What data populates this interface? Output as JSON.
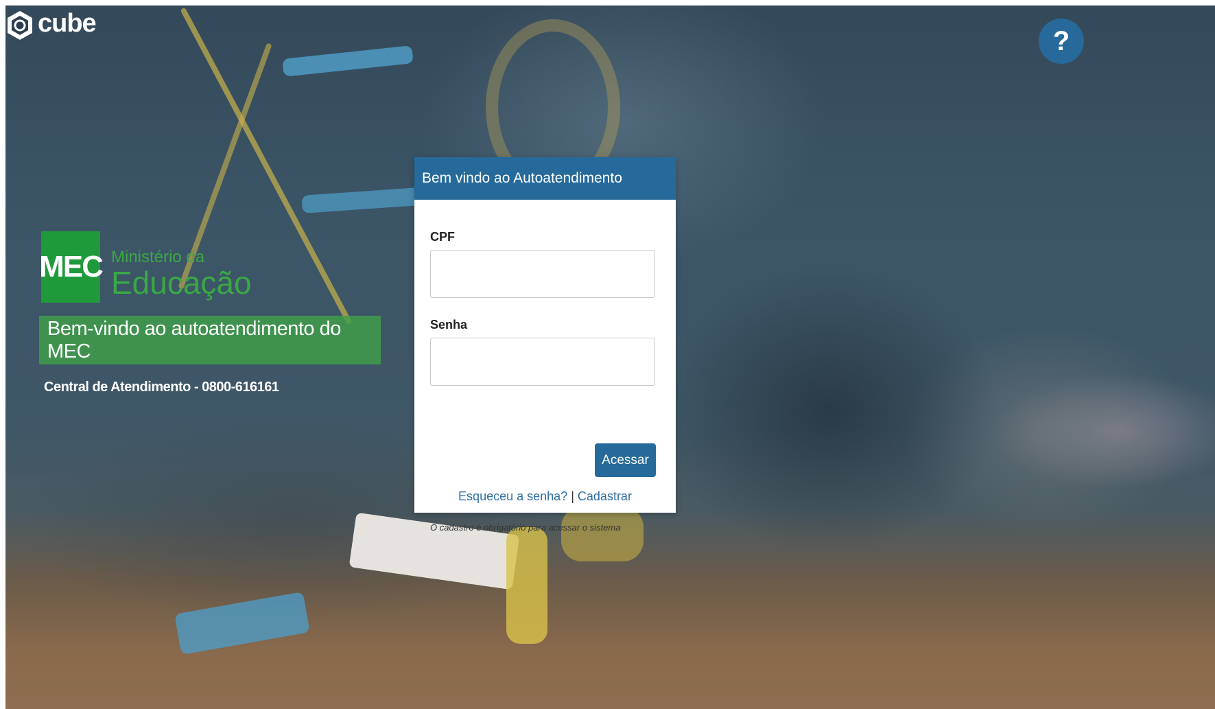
{
  "brand": {
    "name": "cube",
    "icon": "cube-hex-icon"
  },
  "help": {
    "label": "?"
  },
  "mec": {
    "box_label": "MEC",
    "line1": "Ministério da",
    "line2": "Educação",
    "colors": {
      "green": "#1f9a3b"
    }
  },
  "welcome_banner": "Bem-vindo  ao autoatendimento do MEC",
  "phone_line": "Central de Atendimento - 0800-616161",
  "login": {
    "title": "Bem vindo ao Autoatendimento",
    "cpf_label": "CPF",
    "cpf_value": "",
    "senha_label": "Senha",
    "senha_value": "",
    "submit_label": "Acessar",
    "forgot_label": "Esqueceu a senha?",
    "separator": "|",
    "register_label": "Cadastrar",
    "note": "O cadastro é obrigatório para acessar o sistema",
    "colors": {
      "header": "#256a9a",
      "link": "#2f6ea6"
    }
  }
}
